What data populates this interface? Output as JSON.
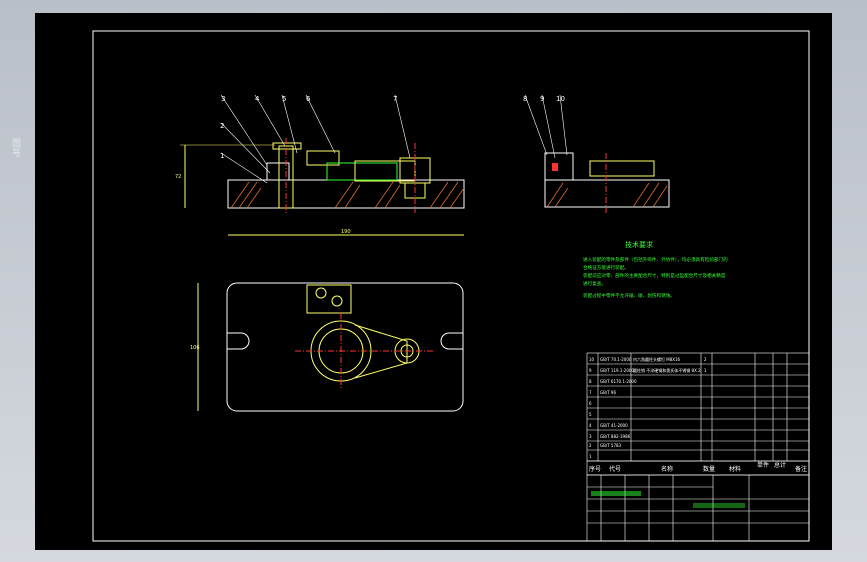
{
  "side_label": "图号",
  "balloons": [
    "1",
    "2",
    "3",
    "4",
    "5",
    "6",
    "7",
    "8",
    "9",
    "10"
  ],
  "dims": {
    "height": "72",
    "length": "190",
    "width": "106"
  },
  "tech": {
    "title": "技术要求",
    "lines": [
      "进入装配的零件及部件（包括外购件、外协件），均必须具有检验部门的",
      "合格证方能进行装配。",
      "装配前应对零、部件的主要配合尺寸，特别是过盈配合尺寸及相关精度",
      "进行复查。",
      "装配过程中零件不允许磕、碰、划伤和锈蚀。"
    ]
  },
  "bom": {
    "rows": [
      {
        "no": "10",
        "code": "GB/T 70.1-2000",
        "name": "内六角圆柱头螺钉 M8X16",
        "qty": "2",
        "mat": "",
        "note": ""
      },
      {
        "no": "9",
        "code": "GB/T 119.1-2000",
        "name": "圆柱销 不淬硬钢和奥氏体不锈钢 8X 2",
        "qty": "1",
        "mat": "",
        "note": ""
      },
      {
        "no": "8",
        "code": "GB/T 6170.1-2000",
        "name": "",
        "qty": "",
        "mat": "",
        "note": ""
      },
      {
        "no": "7",
        "code": "GB/T 96",
        "name": "",
        "qty": "",
        "mat": "",
        "note": ""
      },
      {
        "no": "6",
        "code": "",
        "name": "",
        "qty": "",
        "mat": "",
        "note": ""
      },
      {
        "no": "5",
        "code": "",
        "name": "",
        "qty": "",
        "mat": "",
        "note": ""
      },
      {
        "no": "4",
        "code": "GB/T 41-2000",
        "name": "",
        "qty": "",
        "mat": "",
        "note": ""
      },
      {
        "no": "3",
        "code": "GB/T 882-1986",
        "name": "",
        "qty": "",
        "mat": "",
        "note": ""
      },
      {
        "no": "2",
        "code": "GB/T 5783",
        "name": "",
        "qty": "",
        "mat": "",
        "note": ""
      },
      {
        "no": "1",
        "code": "",
        "name": "",
        "qty": "",
        "mat": "",
        "note": ""
      }
    ],
    "headers": {
      "no": "序号",
      "code": "代号",
      "name": "名称",
      "qty": "数量",
      "mat": "材料",
      "unit": "单件",
      "total": "总计",
      "weight": "重量",
      "note": "备注"
    }
  },
  "colors": {
    "frame": "#ffffff",
    "part": "#ffff66",
    "green": "#33ff33",
    "cyan": "#55ddff",
    "magenta": "#ff55ff",
    "hatch": "#dd6633",
    "center": "#ff3333"
  }
}
